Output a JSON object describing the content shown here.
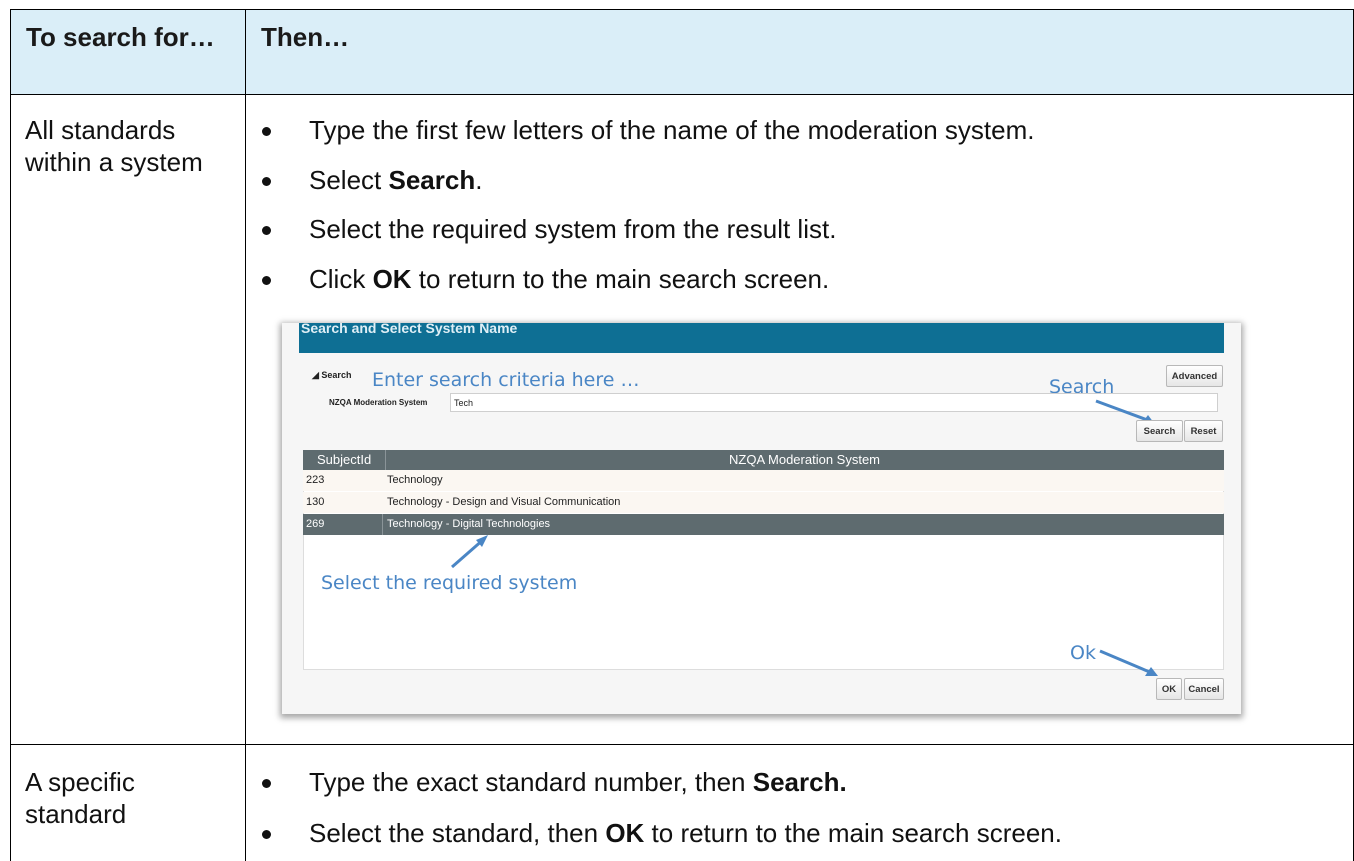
{
  "table": {
    "header": {
      "col1": "To search for…",
      "col2": "Then…"
    },
    "rows": [
      {
        "search_for": "All standards within a system",
        "steps": [
          {
            "text": "Type the first few letters of the name of the moderation system."
          },
          {
            "pre": "Select ",
            "bold": "Search",
            "post": "."
          },
          {
            "text": "Select the required system from the result list."
          },
          {
            "pre": "Click ",
            "bold": "OK",
            "post": " to return to the main search screen."
          }
        ]
      },
      {
        "search_for": "A specific standard",
        "steps": [
          {
            "pre": "Type the exact standard number, then ",
            "bold": "Search.",
            "post": ""
          },
          {
            "pre": "Select the standard, then ",
            "bold": "OK",
            "post": " to return to the main search screen."
          }
        ]
      }
    ]
  },
  "dialog": {
    "title": "Search and Select System Name",
    "search_section_label": "Search",
    "annotation_criteria": "Enter search criteria here …",
    "annotation_search": "Search",
    "annotation_select": "Select the required  system",
    "annotation_ok": "Ok",
    "advanced_button": "Advanced",
    "field_label": "NZQA Moderation System",
    "field_value": "Tech",
    "search_button": "Search",
    "reset_button": "Reset",
    "columns": [
      "SubjectId",
      "NZQA Moderation System"
    ],
    "results": [
      {
        "id": "223",
        "name": "Technology"
      },
      {
        "id": "130",
        "name": "Technology - Design and Visual Communication"
      },
      {
        "id": "269",
        "name": "Technology - Digital Technologies"
      }
    ],
    "ok_button": "OK",
    "cancel_button": "Cancel"
  },
  "colors": {
    "header_bg": "#daeef8",
    "dialog_title_bg": "#0e6f94",
    "table_header_bg": "#5e6b6f",
    "selected_row_bg": "#5e6b6f",
    "annotation": "#4a86c5"
  }
}
